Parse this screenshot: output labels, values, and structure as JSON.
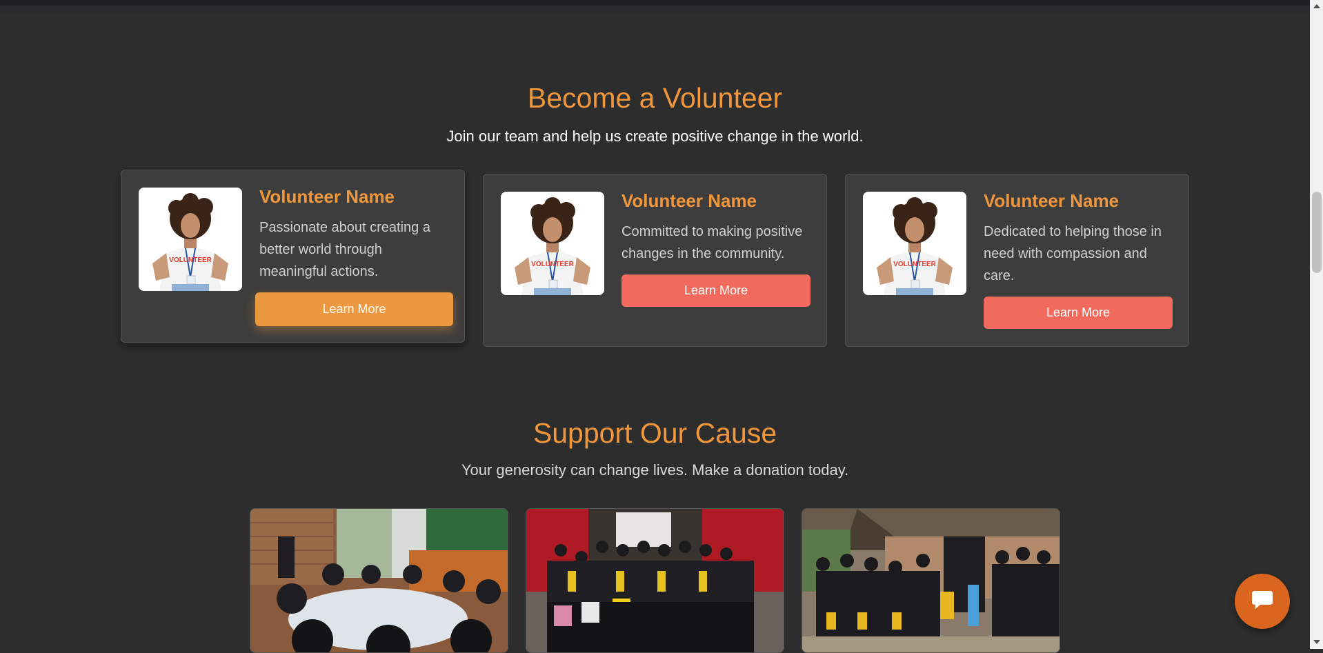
{
  "volunteer": {
    "title": "Become a Volunteer",
    "subtitle": "Join our team and help us create positive change in the world.",
    "cards": [
      {
        "name": "Volunteer Name",
        "text": "Passionate about creating a better world through meaningful actions.",
        "button": "Learn More",
        "shirt_text": "VOLUNTEER"
      },
      {
        "name": "Volunteer Name",
        "text": "Committed to making positive changes in the community.",
        "button": "Learn More",
        "shirt_text": "VOLUNTEER"
      },
      {
        "name": "Volunteer Name",
        "text": "Dedicated to helping those in need with compassion and care.",
        "button": "Learn More",
        "shirt_text": "VOLUNTEER"
      }
    ]
  },
  "cause": {
    "title": "Support Our Cause",
    "subtitle": "Your generosity can change lives. Make a donation today."
  },
  "colors": {
    "accent": "#f0963c",
    "button_hover": "#ec9840",
    "button": "#f26a5e",
    "background": "#2d2d2d",
    "card": "#3d3d3d",
    "chat": "#d9651f"
  },
  "icons": {
    "chat": "chat-bubble-icon"
  }
}
